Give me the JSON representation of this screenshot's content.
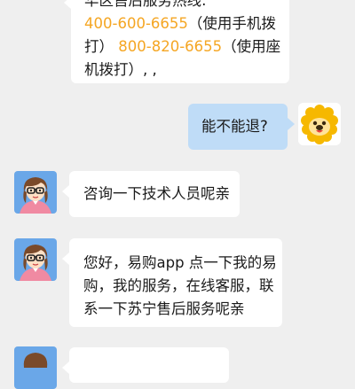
{
  "messages": [
    {
      "side": "agent",
      "line1": "华区售后服务热线:",
      "phone1": "400-600-6655",
      "phone1_note": "（使用手机拨",
      "line3_a": "打）",
      "phone2": "800-820-6655",
      "phone2_note": "（使用座",
      "line4": "机拨打）, ,"
    },
    {
      "side": "user",
      "text": "能不能退?"
    },
    {
      "side": "agent",
      "text": "咨询一下技术人员呢亲"
    },
    {
      "side": "agent",
      "line1": "您好，易购app 点一下我的易",
      "line2": "购，我的服务，在线客服，联",
      "line3": "系一下苏宁售后服务呢亲"
    }
  ],
  "colors": {
    "phone": "#f5a623",
    "user_bubble": "#bfdcf7",
    "agent_bubble": "#ffffff",
    "background": "#efefef"
  },
  "icons": {
    "agent_avatar": "agent-girl-avatar-icon",
    "user_avatar": "suning-lion-avatar-icon"
  }
}
